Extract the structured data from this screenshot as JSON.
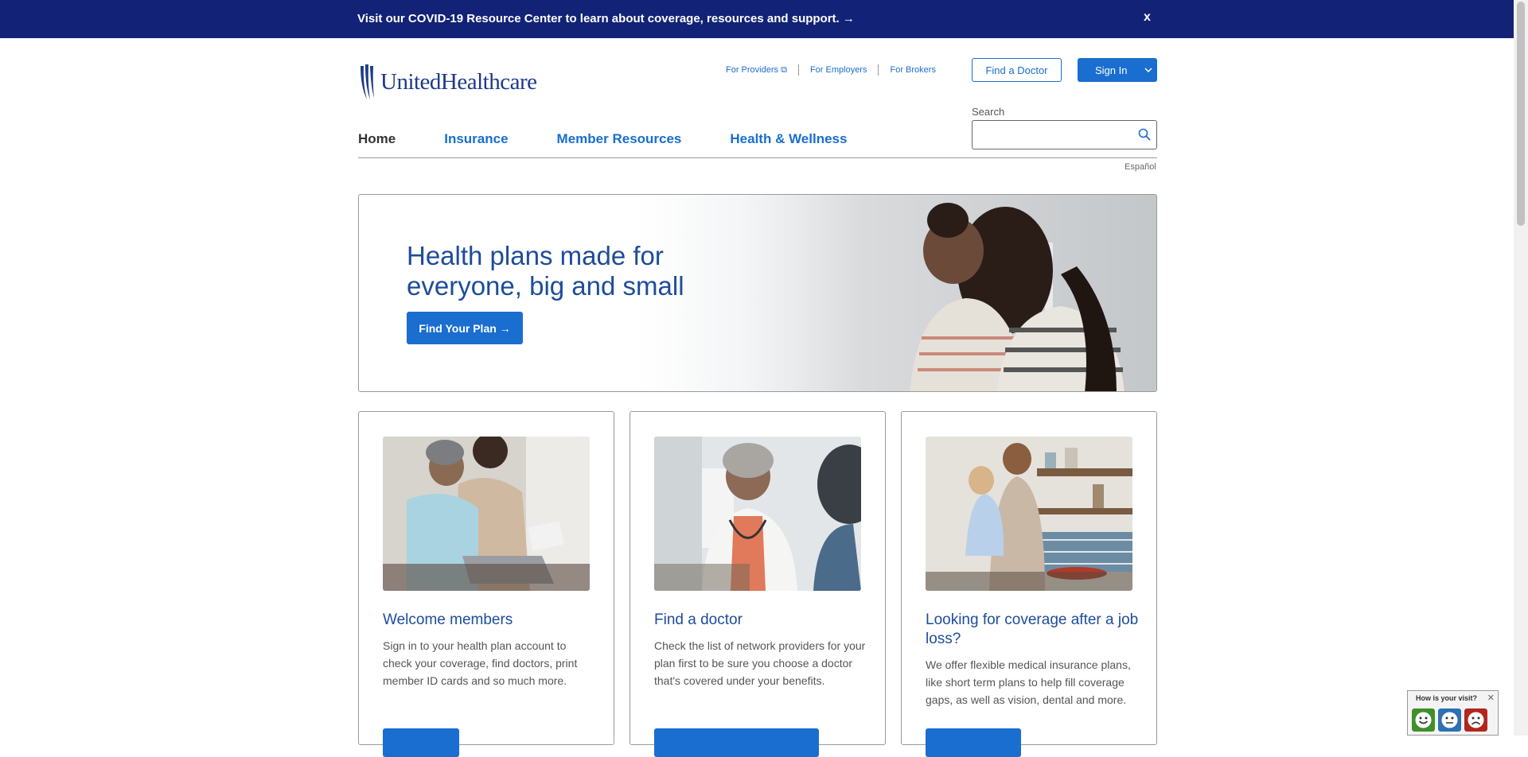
{
  "banner": {
    "text": "Visit our COVID-19 Resource Center to learn about coverage, resources and support. →",
    "close": "x"
  },
  "brand": {
    "name": "UnitedHealthcare"
  },
  "utility_links": [
    {
      "label": "For Providers"
    },
    {
      "label": "For Employers"
    },
    {
      "label": "For Brokers"
    }
  ],
  "header": {
    "find_doctor": "Find a Doctor",
    "sign_in": "Sign In",
    "search_label": "Search",
    "espanol": "Español"
  },
  "nav": [
    {
      "label": "Home"
    },
    {
      "label": "Insurance"
    },
    {
      "label": "Member Resources"
    },
    {
      "label": "Health & Wellness"
    }
  ],
  "hero": {
    "title": "Health plans made for everyone, big and small",
    "cta": "Find Your Plan →"
  },
  "cards": [
    {
      "title": "Welcome members",
      "body": "Sign in to your health plan account to check your coverage, find doctors, print member ID cards and so much more."
    },
    {
      "title": "Find a doctor",
      "body": "Check the list of network providers for your plan first to be sure you choose a doctor that's covered under your benefits."
    },
    {
      "title": "Looking for coverage after a job loss?",
      "body": "We offer flexible medical insurance plans, like short term plans to help fill coverage gaps, as well as vision, dental and more."
    }
  ],
  "feedback": {
    "title": "How is your visit?",
    "close": "✕"
  },
  "colors": {
    "navy": "#122377",
    "brand_blue": "#196ecf",
    "heading_blue": "#1d4c9b"
  }
}
